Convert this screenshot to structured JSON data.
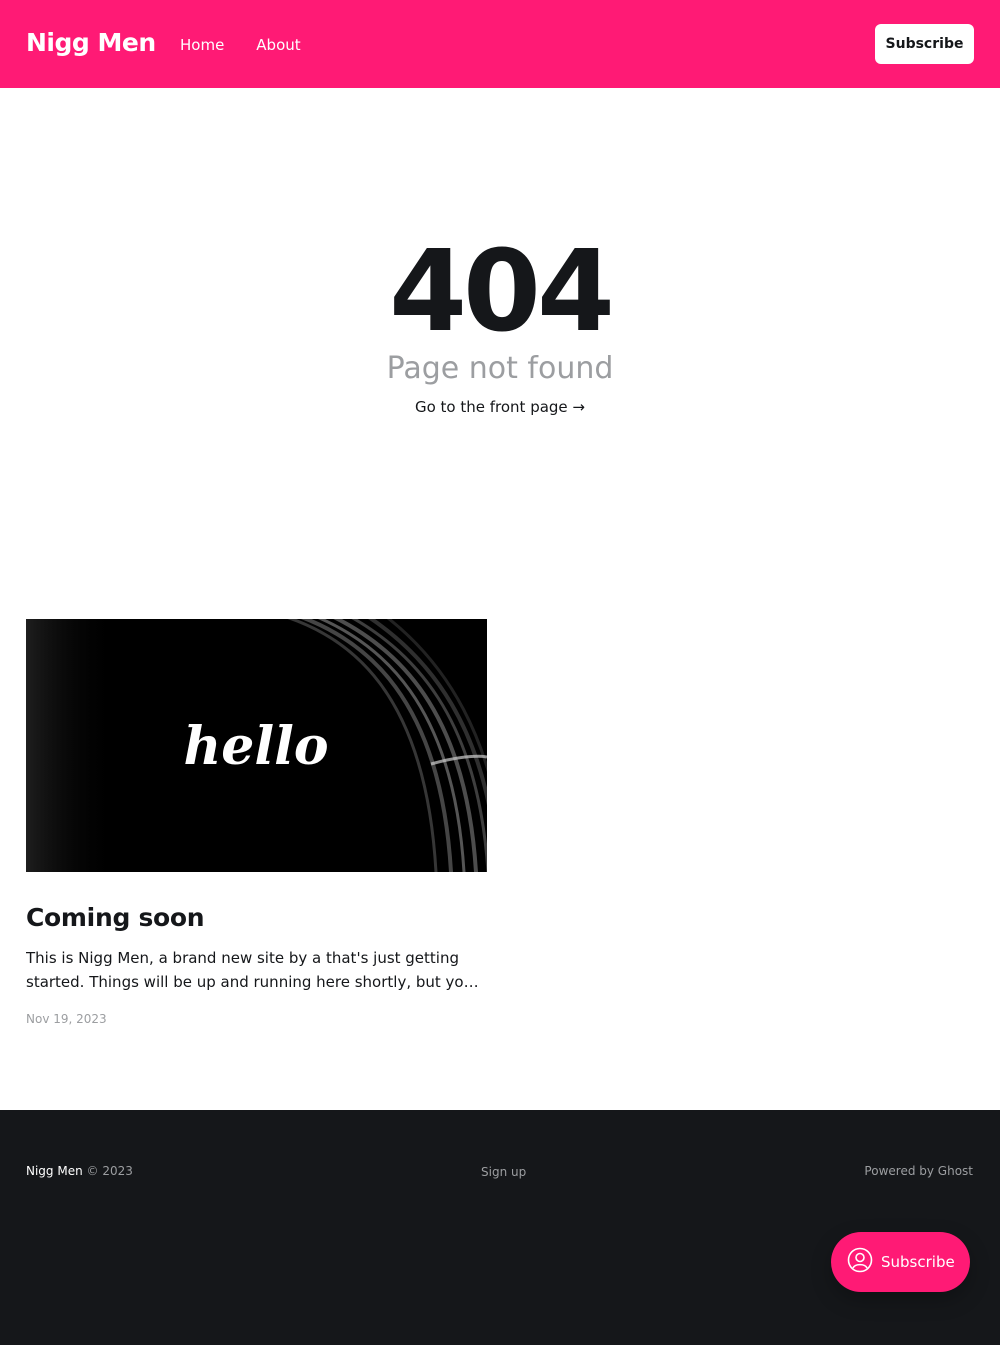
{
  "header": {
    "logo": "Nigg Men",
    "nav": [
      {
        "label": "Home"
      },
      {
        "label": "About"
      }
    ],
    "subscribe_label": "Subscribe",
    "bg_color": "#ff1a75"
  },
  "error": {
    "code": "404",
    "description": "Page not found",
    "link": "Go to the front page →"
  },
  "post": {
    "image_text": "hello",
    "title": "Coming soon",
    "excerpt": "This is Nigg Men, a brand new site by a that's just getting started. Things will be up and running here shortly, but you can subscribe in the meantime if you'd like to stay up to date and receive emails when new content is published!",
    "date": "Nov 19, 2023"
  },
  "footer": {
    "site_name": "Nigg Men",
    "copyright": "© 2023",
    "signup": "Sign up",
    "powered": "Powered by Ghost"
  },
  "portal": {
    "label": "Subscribe",
    "icon": "user-circle-icon"
  }
}
